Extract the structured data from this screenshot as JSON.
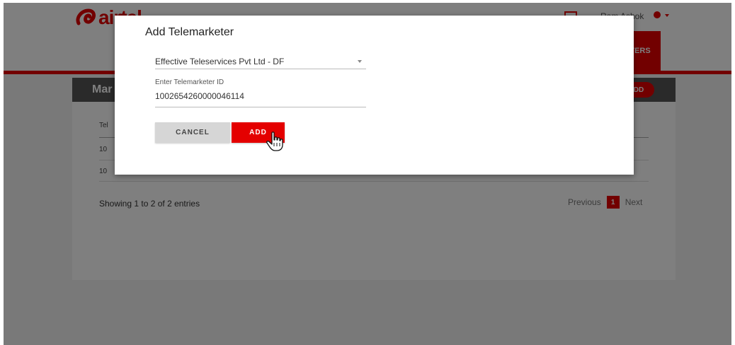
{
  "header": {
    "logo_text": "airtel",
    "user_name": "Ram Ashok",
    "brand_color": "#e40000"
  },
  "nav": {
    "active_tab_label": "TERS"
  },
  "card": {
    "title": "Mar",
    "add_label": "DD",
    "table": {
      "header_text": "Tel",
      "rows": [
        "10",
        "10"
      ]
    },
    "showing_text": "Showing 1 to 2 of 2 entries",
    "pager": {
      "previous": "Previous",
      "current_page": "1",
      "next": "Next"
    }
  },
  "modal": {
    "title": "Add Telemarketer",
    "select_value": "Effective Teleservices Pvt Ltd - DF",
    "field_label": "Enter Telemarketer ID",
    "field_value": "1002654260000046114",
    "cancel_label": "CANCEL",
    "add_label": "ADD"
  },
  "icons": {
    "mail": "mail-icon",
    "avatar": "user-icon",
    "cursor": "hand-pointer-icon"
  }
}
